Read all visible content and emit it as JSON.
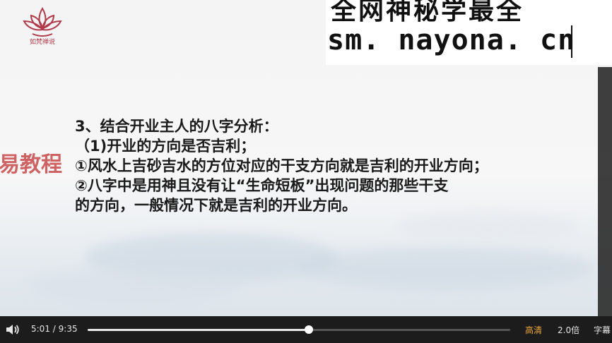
{
  "logo": {
    "caption": "如梵禅说"
  },
  "watermark": {
    "title": "全网神秘学最全",
    "url": "sm. nayona. cn",
    "side": "易教程"
  },
  "slide": {
    "lines": [
      "3、结合开业主人的八字分析：",
      "（1)开业的方向是否吉利；",
      "①风水上吉砂吉水的方位对应的干支方向就是吉利的开业方向；",
      "②八字中是用神且没有让“生命短板”出现问题的那些干支",
      "的方向，一般情况下就是吉利的开业方向。"
    ]
  },
  "player": {
    "current_time": "5:01",
    "separator": "/",
    "duration": "9:35",
    "progress": 0.524,
    "quality": "高清",
    "speed": "2.0倍",
    "subtitles": "字幕",
    "icons": {
      "volume": "volume-icon"
    },
    "colors": {
      "quality": "#f0a83a",
      "bar_bg": "#1c1c1c"
    }
  }
}
